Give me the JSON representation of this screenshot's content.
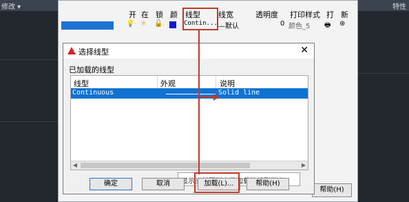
{
  "topbar": {
    "left": "修改 ▾",
    "right": "特性"
  },
  "layer_table": {
    "headers": [
      "开",
      "在",
      "锁",
      "颜",
      "线型",
      "线宽",
      "透明度",
      "打印样式",
      "打",
      "新"
    ],
    "row": {
      "linetype": "Contin...",
      "lineweight": "—默认",
      "transparency": "0",
      "plot_style": "颜色_5"
    },
    "help_label": "帮助(H)"
  },
  "dialog": {
    "title": "选择线型",
    "close": "✕",
    "loaded_label": "已加载的线型",
    "columns": [
      "线型",
      "外观",
      "说明"
    ],
    "rows": [
      {
        "linetype": "Continuous",
        "description": "Solid line"
      }
    ],
    "tooltip": "显示当前图形中已加载的线型列表。",
    "buttons": {
      "ok": "确定",
      "cancel": "取消",
      "load": "加载(L)...",
      "help": "帮助(H)"
    }
  },
  "colors": {
    "accent": "#1e73d2",
    "annotation": "#c0392b",
    "autocad_red": "#d4242b"
  }
}
